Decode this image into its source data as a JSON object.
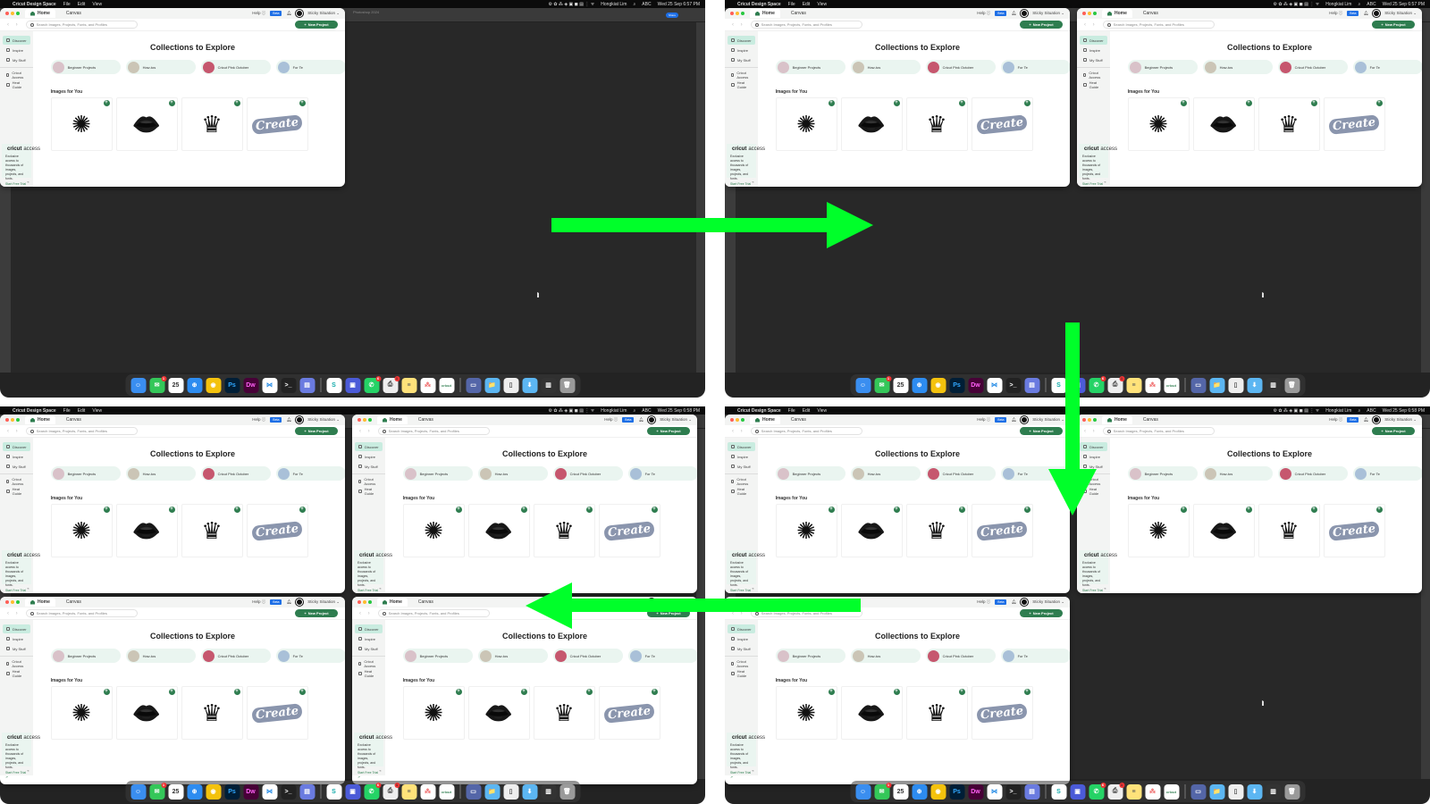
{
  "menubar": {
    "app": "Cricut Design Space",
    "items": [
      "File",
      "Edit",
      "View"
    ],
    "user": "Hongkiat Lim",
    "input": "ABC",
    "datetime_top": "Wed 25 Sep 6:57 PM",
    "datetime_bottom": "Wed 25 Sep 6:58 PM"
  },
  "photoshop": {
    "doc_title": "Photoshop 2024",
    "share_label": "Share"
  },
  "cricut": {
    "tabs": [
      {
        "label": "Home"
      },
      {
        "label": "Canvas"
      }
    ],
    "help_label": "Help",
    "beta_label": "Beta",
    "user_name": "Sticky Situation",
    "search_placeholder": "Search Images, Projects, Fonts, and Profiles",
    "new_project_label": "New Project",
    "sidebar": {
      "items": [
        {
          "label": "Discover",
          "icon": "bulb-icon",
          "active": true
        },
        {
          "label": "Inspire",
          "icon": "hash-icon"
        },
        {
          "label": "My Stuff",
          "icon": "folder-icon"
        }
      ],
      "items2": [
        {
          "label": "Cricut Access",
          "icon": "lock-icon"
        },
        {
          "label": "Heat Guide",
          "icon": "heat-icon"
        }
      ]
    },
    "promo": {
      "brand": "cricut",
      "brand_suffix": "access",
      "text": "Exclusive access to thousands of images, projects, and fonts.",
      "cta": "Start Free Trial ↗"
    },
    "collections_title": "Collections to Explore",
    "collections": [
      {
        "label": "Beginner Projects"
      },
      {
        "label": "How-tos"
      },
      {
        "label": "Cricut Pink October"
      },
      {
        "label": "For Te"
      }
    ],
    "images_title": "Images for You",
    "images": [
      {
        "name": "sunflower",
        "glyph": "✺"
      },
      {
        "name": "lips",
        "glyph": "👄"
      },
      {
        "name": "crown",
        "glyph": "♛"
      },
      {
        "name": "create",
        "glyph": "Create"
      }
    ]
  },
  "dock": {
    "apps": [
      {
        "name": "Finder",
        "color": "#3a8ef0",
        "glyph": "☺"
      },
      {
        "name": "Messages",
        "color": "#34c759",
        "glyph": "✉",
        "badge": "1"
      },
      {
        "name": "Calendar",
        "color": "#ffffff",
        "glyph": "25",
        "text": "#333"
      },
      {
        "name": "Safari",
        "color": "#2d8cf0",
        "glyph": "⊕"
      },
      {
        "name": "Chrome",
        "color": "#f4c20d",
        "glyph": "◉"
      },
      {
        "name": "Photoshop",
        "color": "#001e36",
        "glyph": "Ps",
        "text": "#31a8ff"
      },
      {
        "name": "Dreamweaver",
        "color": "#470137",
        "glyph": "Dw",
        "text": "#ff61f6"
      },
      {
        "name": "VS Code",
        "color": "#ffffff",
        "glyph": "⋈",
        "text": "#1e88e5"
      },
      {
        "name": "Terminal",
        "color": "#222222",
        "glyph": ">_"
      },
      {
        "name": "Archive Utility",
        "color": "#6a7be0",
        "glyph": "▤"
      },
      {
        "sep": true
      },
      {
        "name": "Surfshark",
        "color": "#ffffff",
        "glyph": "S",
        "text": "#1aa"
      },
      {
        "name": "Screen Sharing",
        "color": "#4b5bd8",
        "glyph": "▣"
      },
      {
        "name": "WhatsApp",
        "color": "#25d366",
        "glyph": "✆",
        "badge": "6"
      },
      {
        "name": "Printer",
        "color": "#eeeeee",
        "glyph": "⎙",
        "text": "#333",
        "badge": "1"
      },
      {
        "name": "Notes",
        "color": "#ffe27a",
        "glyph": "≡",
        "text": "#555"
      },
      {
        "name": "Asana",
        "color": "#ffffff",
        "glyph": "⁂",
        "text": "#f06a6a"
      },
      {
        "name": "Cricut",
        "color": "#ffffff",
        "glyph": "cricut",
        "text": "#2e7d4f"
      },
      {
        "sep": true
      },
      {
        "name": "Screenshot",
        "color": "#5466a8",
        "glyph": "▭"
      },
      {
        "name": "Folder",
        "color": "#5cb6f2",
        "glyph": "📁"
      },
      {
        "name": "Document",
        "color": "#eeeeee",
        "glyph": "▯",
        "text": "#555"
      },
      {
        "name": "Downloads",
        "color": "#5cb6f2",
        "glyph": "⬇"
      },
      {
        "name": "Stacks",
        "color": "#333333",
        "glyph": "▥"
      },
      {
        "name": "Trash",
        "color": "#9a9a9a",
        "glyph": "🗑"
      }
    ]
  },
  "annotations": {
    "arrow_color": "#00ff2a",
    "arrows": [
      "right",
      "down",
      "left"
    ]
  },
  "colors": {
    "cricut_green": "#2e7d4f",
    "active_sidebar": "#c9ece0",
    "beta_blue": "#1e6fe6"
  }
}
